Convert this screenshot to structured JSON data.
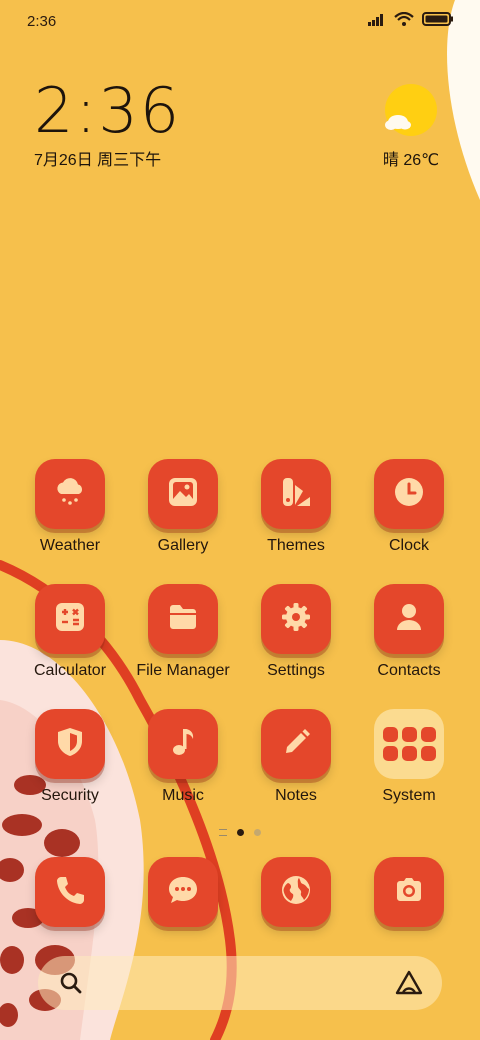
{
  "status_bar": {
    "time": "2:36",
    "signal_icon": "signal-bars-icon",
    "wifi_icon": "wifi-icon",
    "battery_icon": "battery-full-icon"
  },
  "clock_widget": {
    "time": "2:36",
    "date": "7月26日 周三下午"
  },
  "weather_widget": {
    "icon": "sun-cloud-icon",
    "text": "晴 26℃"
  },
  "apps": [
    {
      "label": "Weather",
      "icon": "cloud-rain-icon"
    },
    {
      "label": "Gallery",
      "icon": "image-icon"
    },
    {
      "label": "Themes",
      "icon": "palette-icon"
    },
    {
      "label": "Clock",
      "icon": "clock-icon"
    },
    {
      "label": "Calculator",
      "icon": "calculator-icon"
    },
    {
      "label": "File Manager",
      "icon": "folder-icon"
    },
    {
      "label": "Settings",
      "icon": "gear-icon"
    },
    {
      "label": "Contacts",
      "icon": "person-icon"
    },
    {
      "label": "Security",
      "icon": "shield-icon"
    },
    {
      "label": "Music",
      "icon": "music-note-icon"
    },
    {
      "label": "Notes",
      "icon": "pencil-icon"
    },
    {
      "label": "System",
      "icon": "folder-grid-icon"
    }
  ],
  "dock": [
    {
      "icon": "phone-icon"
    },
    {
      "icon": "message-icon"
    },
    {
      "icon": "globe-icon"
    },
    {
      "icon": "camera-icon"
    }
  ],
  "page_indicator": {
    "pages": 2,
    "active": 0
  },
  "search": {
    "search_icon": "search-icon",
    "assistant_icon": "assistant-icon"
  },
  "colors": {
    "background": "#f6c04c",
    "tile": "#e4472b",
    "glyph": "#ffd9a8",
    "text": "#24170d"
  }
}
